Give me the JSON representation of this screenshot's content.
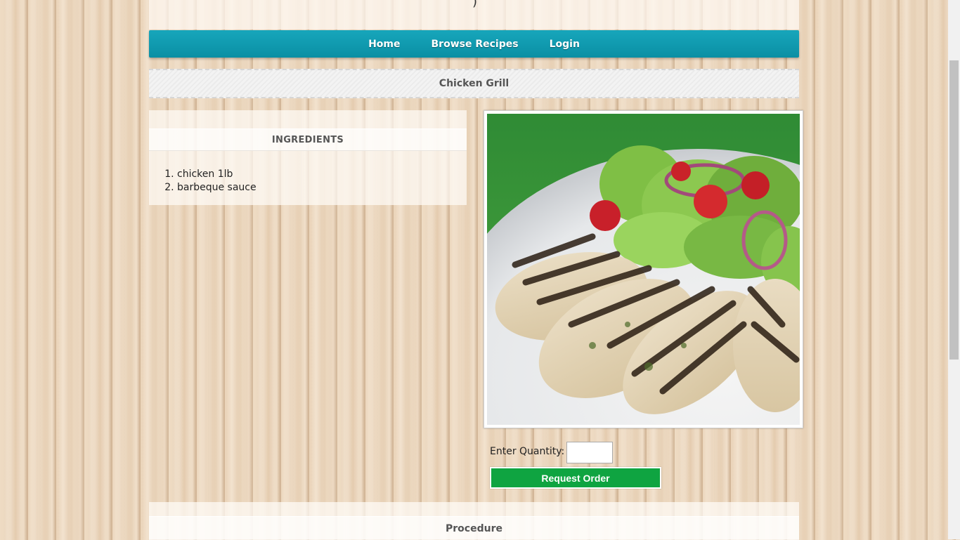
{
  "header": {
    "mark": ")"
  },
  "nav": {
    "items": [
      "Home",
      "Browse Recipes",
      "Login"
    ]
  },
  "recipe": {
    "title": "Chicken Grill"
  },
  "ingredients": {
    "heading": "INGREDIENTS",
    "items": [
      "chicken 1lb",
      "barbeque sauce"
    ]
  },
  "order": {
    "quantity_label": "Enter Quantity:",
    "quantity_value": "",
    "button_label": "Request Order"
  },
  "procedure": {
    "heading": "Procedure"
  },
  "colors": {
    "nav_bg": "#0a8fa4",
    "order_button": "#0fa441",
    "background_wood": "#efdcc4"
  }
}
